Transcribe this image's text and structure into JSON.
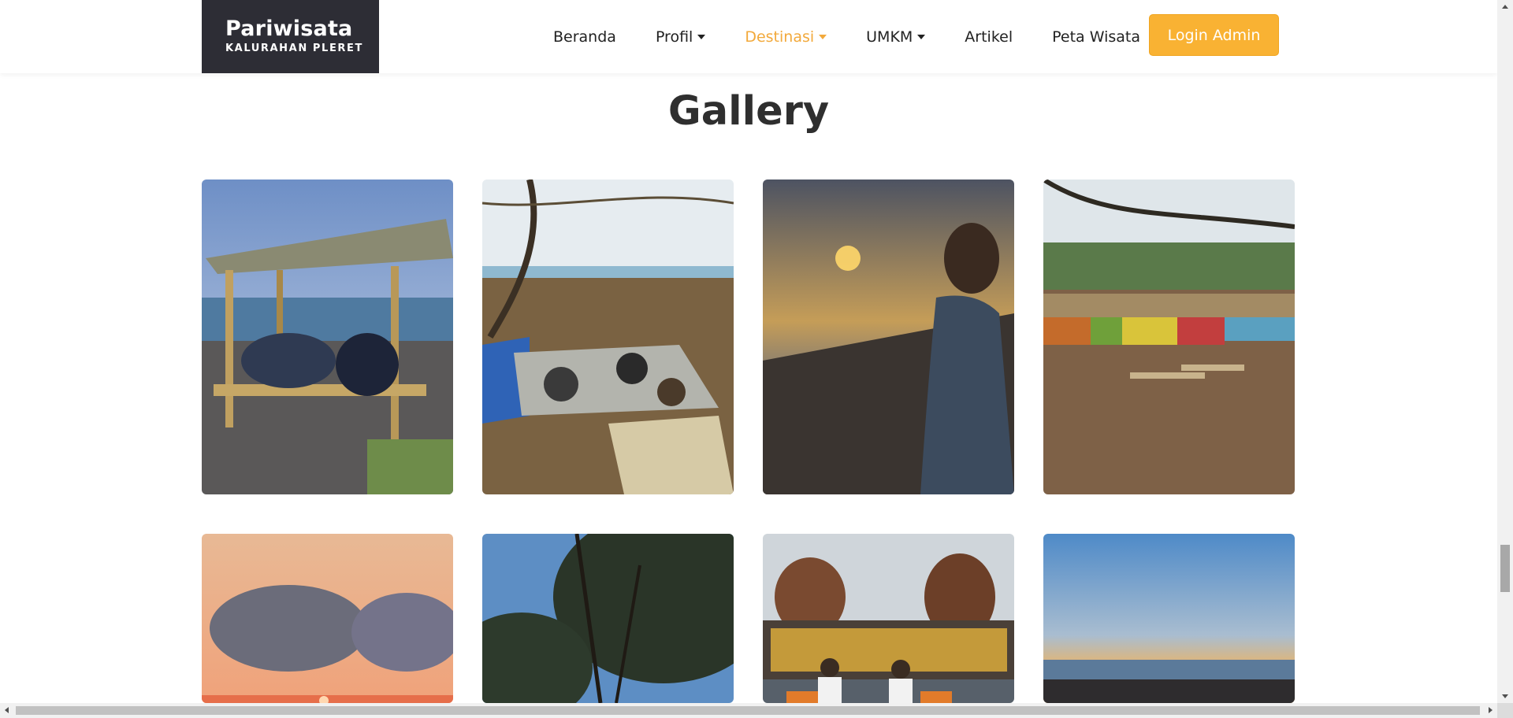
{
  "brand": {
    "title": "Pariwisata",
    "subtitle": "KALURAHAN PLERET"
  },
  "nav": {
    "items": [
      {
        "label": "Beranda",
        "dropdown": false,
        "active": false
      },
      {
        "label": "Profil",
        "dropdown": true,
        "active": false
      },
      {
        "label": "Destinasi",
        "dropdown": true,
        "active": true
      },
      {
        "label": "UMKM",
        "dropdown": true,
        "active": false
      },
      {
        "label": "Artikel",
        "dropdown": false,
        "active": false
      },
      {
        "label": "Peta Wisata",
        "dropdown": false,
        "active": false
      }
    ],
    "login_label": "Login Admin"
  },
  "gallery": {
    "title": "Gallery",
    "photos": [
      {
        "subject": "beach gazebo with people"
      },
      {
        "subject": "group picnic under trees"
      },
      {
        "subject": "boy at beach sunset"
      },
      {
        "subject": "colorful beach stalls with benches"
      },
      {
        "subject": "sunset clouds"
      },
      {
        "subject": "pine tree canopy"
      },
      {
        "subject": "Parangan sign with men"
      },
      {
        "subject": "calm beach at dusk"
      }
    ]
  },
  "colors": {
    "accent": "#f9b233",
    "brand_bg": "#2d2d35",
    "active_nav": "#f2a93b"
  }
}
